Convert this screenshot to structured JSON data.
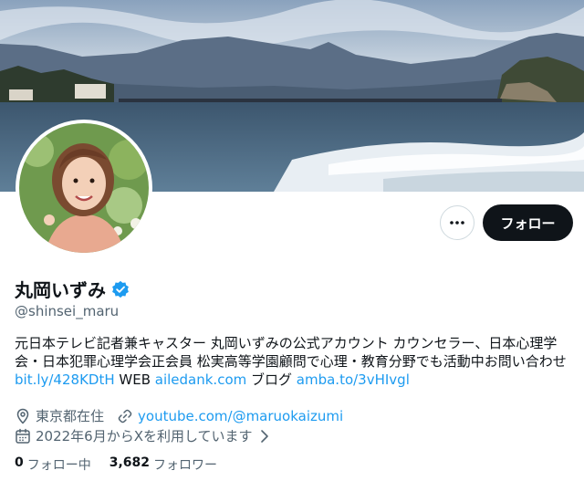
{
  "profile": {
    "name": "丸岡いずみ",
    "handle": "@shinsei_maru",
    "follow_label": "フォロー",
    "bio_line1": "元日本テレビ記者兼キャスター 丸岡いずみの公式アカウント カウンセラー、日本心理学",
    "bio_line2": "会・日本犯罪心理学会正会員 松実高等学園顧問で心理・教育分野でも活動中お問い合わせ",
    "bio_link1": "bit.ly/428KDtH",
    "bio_text_web": " WEB ",
    "bio_link2": "ailedank.com",
    "bio_text_blog": " ブログ ",
    "bio_link3": "amba.to/3vHIvgl",
    "location": "東京都在住",
    "website": "youtube.com/@maruokaizumi",
    "joined": "2022年6月からXを利用しています",
    "following_count": "0",
    "following_label": "フォロー中",
    "followers_count": "3,682",
    "followers_label": "フォロワー"
  },
  "colors": {
    "accent": "#1d9bf0",
    "button_dark": "#0f1419",
    "muted_text": "#536471"
  },
  "icons": [
    "more-icon",
    "verified-badge-icon",
    "location-icon",
    "link-icon",
    "calendar-icon",
    "chevron-right-icon"
  ]
}
